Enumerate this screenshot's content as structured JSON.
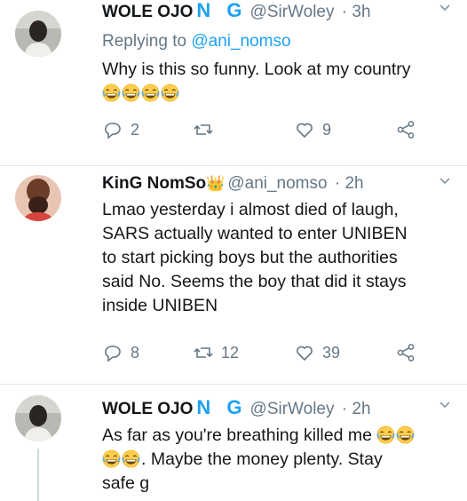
{
  "tweets": [
    {
      "name": "WOLE OJO",
      "name_suffix": "N G",
      "handle": "@SirWoley",
      "time": "· 3h",
      "replying_label": "Replying to",
      "replying_to": "@ani_nomso",
      "text": "Why is this so funny. Look at my country",
      "emoji_line": [
        "laughing-emoji",
        "laughing-emoji",
        "laughing-emoji",
        "laughing-emoji"
      ],
      "replies": "2",
      "retweets": "",
      "likes": "9"
    },
    {
      "name": "KinG NomSo",
      "name_suffix": "👑",
      "handle": "@ani_nomso",
      "time": "· 2h",
      "text_lines": [
        "Lmao yesterday i almost died of laugh,",
        "SARS actually wanted to enter UNIBEN",
        "to start picking boys but the authorities",
        "said No. Seems the boy that did it stays",
        "inside UNIBEN"
      ],
      "replies": "8",
      "retweets": "12",
      "likes": "39"
    },
    {
      "name": "WOLE OJO",
      "name_suffix": "N G",
      "handle": "@SirWoley",
      "time": "· 2h",
      "text_line1": "As far as you're breathing killed me",
      "text_line2": ". Maybe the money plenty. Stay",
      "text_line3": "safe g"
    }
  ],
  "colors": {
    "accent": "#1da1f2",
    "muted": "#657786",
    "text": "#14171a",
    "divider": "#e1e8ed",
    "emoji": "#ffcc4d"
  }
}
